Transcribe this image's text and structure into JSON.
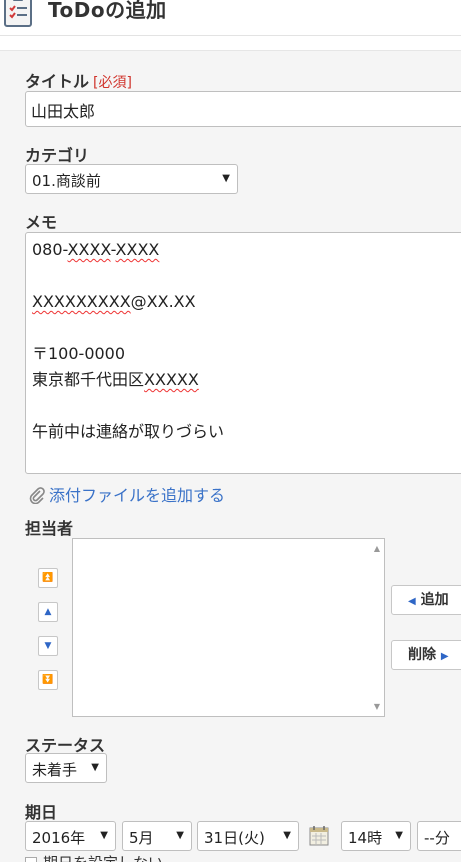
{
  "header": {
    "title": "ToDoの追加",
    "icon": "todo-list-icon"
  },
  "form": {
    "title_label": "タイトル",
    "required_label": "[必須]",
    "title_value": "山田太郎",
    "category_label": "カテゴリ",
    "category_value": "01.商談前",
    "memo_label": "メモ",
    "memo_lines": [
      "080-XXXX-XXXX",
      "",
      "XXXXXXXXX@XX.XX",
      "",
      "〒100-0000",
      "東京都千代田区XXXXX",
      "",
      "午前中は連絡が取りづらい"
    ],
    "attach_label": "添付ファイルを追加する",
    "assignee_label": "担当者",
    "add_button": "追加",
    "remove_button": "削除",
    "status_label": "ステータス",
    "status_value": "未着手",
    "due_label": "期日",
    "due_year": "2016年",
    "due_month": "5月",
    "due_day": "31日(火)",
    "due_hour": "14時",
    "due_minute": "--分",
    "no_due_label": "期日を設定しない"
  },
  "colors": {
    "link": "#3a72c8",
    "required": "#d0342c",
    "accent": "#2e66c6"
  }
}
